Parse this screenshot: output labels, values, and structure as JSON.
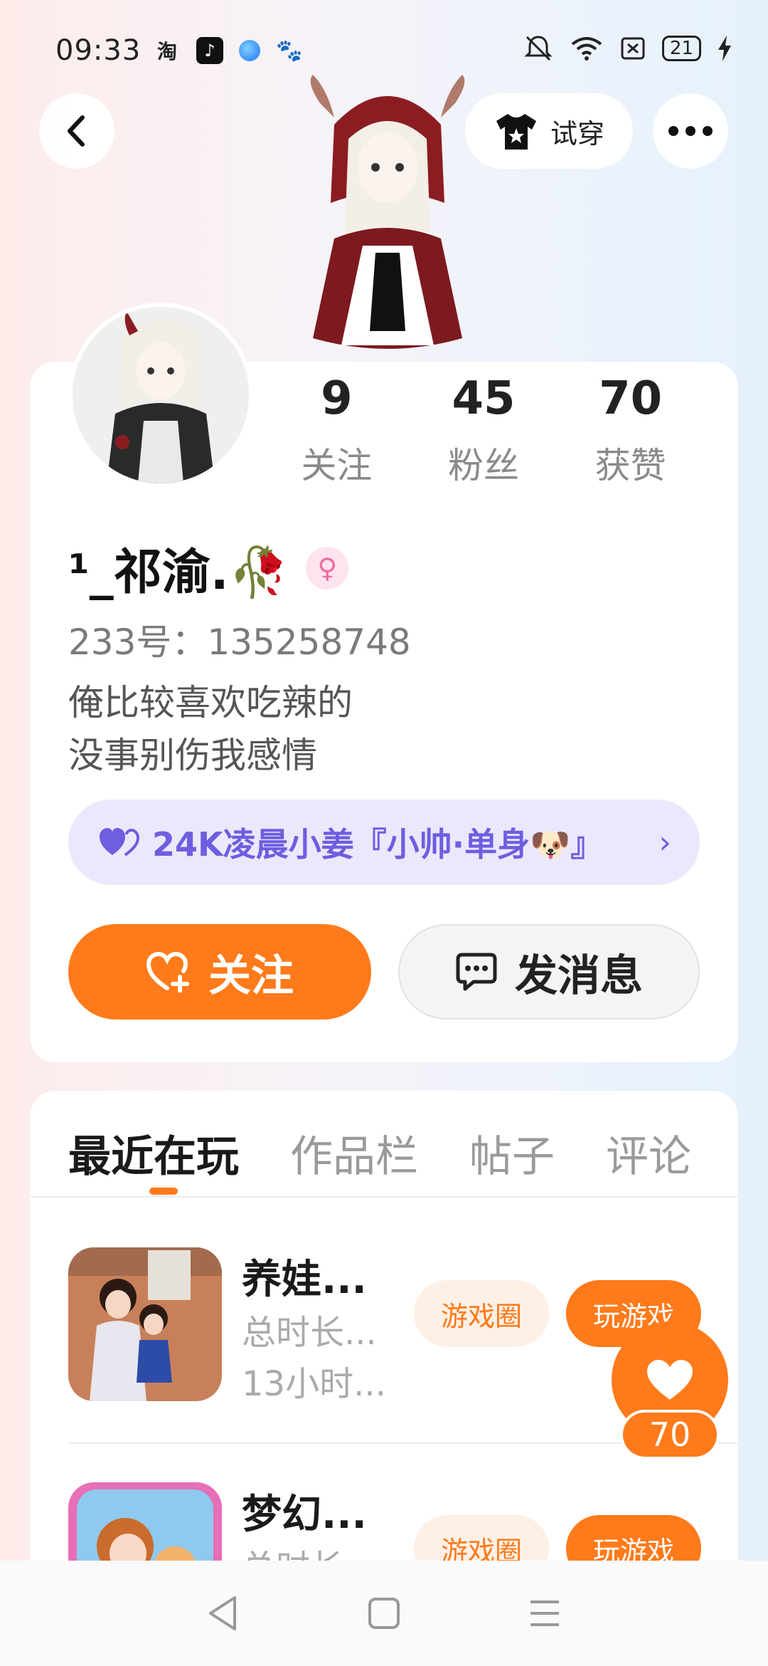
{
  "status_bar": {
    "time": "09:33",
    "apps": [
      "taobao-icon",
      "tiktok-icon",
      "app-icon",
      "baidu-icon"
    ],
    "battery": "21"
  },
  "header": {
    "tryon_label": "试穿"
  },
  "profile": {
    "stats": [
      {
        "value": "9",
        "label": "关注"
      },
      {
        "value": "45",
        "label": "粉丝"
      },
      {
        "value": "70",
        "label": "获赞"
      }
    ],
    "nickname": "¹_祁渝.🥀",
    "uid": "233号：135258748",
    "bio_line1": "俺比较喜欢吃辣的",
    "bio_line2": "没事别伤我感情",
    "team": "24K凌晨小姜『小帅·单身🐶』",
    "follow_label": "关注",
    "message_label": "发消息"
  },
  "tabs": [
    "最近在玩",
    "作品栏",
    "帖子",
    "评论"
  ],
  "games": [
    {
      "title": "养娃...",
      "meta1": "总时长...",
      "meta2": "13小时...",
      "circle_label": "游戏圈",
      "play_label": "玩游戏"
    },
    {
      "title": "梦幻...",
      "meta1": "总时长...",
      "meta2": "",
      "circle_label": "游戏圈",
      "play_label": "玩游戏"
    }
  ],
  "like": {
    "count": "70"
  },
  "colors": {
    "accent": "#ff7a1a",
    "team_purple": "#6e5ee0",
    "team_bg": "#ebe8fb"
  }
}
